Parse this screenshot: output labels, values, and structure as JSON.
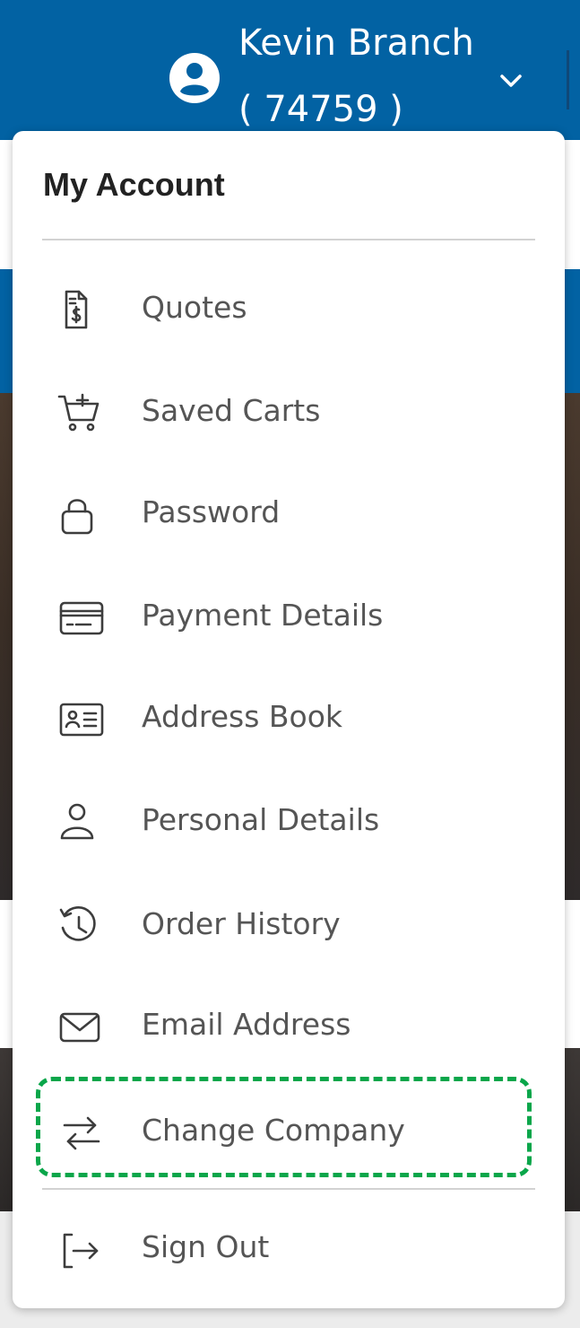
{
  "header": {
    "user_name": "Kevin Branch",
    "user_id": "( 74759 )",
    "avatar_icon": "user-circle-icon",
    "dropdown_icon": "chevron-down-icon",
    "background_color": "#0262a3"
  },
  "account_menu": {
    "title": "My Account",
    "items": [
      {
        "label": "Quotes",
        "icon": "quote-document-icon"
      },
      {
        "label": "Saved Carts",
        "icon": "cart-add-icon"
      },
      {
        "label": "Password",
        "icon": "lock-icon"
      },
      {
        "label": "Payment Details",
        "icon": "credit-card-icon"
      },
      {
        "label": "Address Book",
        "icon": "address-card-icon"
      },
      {
        "label": "Personal Details",
        "icon": "person-icon"
      },
      {
        "label": "Order History",
        "icon": "history-icon"
      },
      {
        "label": "Email Address",
        "icon": "envelope-icon"
      },
      {
        "label": "Change Company",
        "icon": "swap-arrows-icon"
      }
    ],
    "sign_out": {
      "label": "Sign Out",
      "icon": "sign-out-icon"
    },
    "highlighted_item": "Change Company",
    "highlight_color": "#0aa64a"
  }
}
